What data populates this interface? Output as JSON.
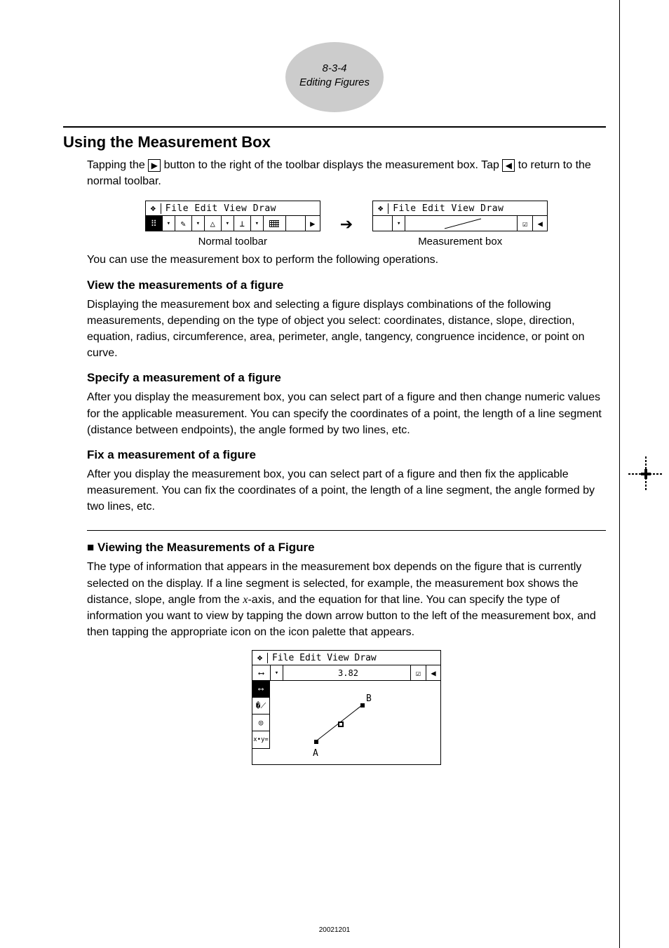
{
  "badge": {
    "line1": "8-3-4",
    "line2": "Editing Figures"
  },
  "h1": "Using the Measurement Box",
  "intro": {
    "seg1": "Tapping the ",
    "icon1": "▶",
    "seg2": " button to the right of the toolbar displays the measurement box. Tap ",
    "icon2": "◀",
    "seg3": " to return to the normal toolbar."
  },
  "menubar": {
    "crown": "❖",
    "file": "File",
    "edit": "Edit",
    "view": "View",
    "draw": "Draw"
  },
  "normal_toolbar_icons": [
    "⠿",
    "▾",
    "✎",
    "▾",
    "△",
    "▾",
    "⊥",
    "▾",
    "",
    "▶"
  ],
  "meas_toolbar": {
    "check": "☑",
    "back": "◀"
  },
  "captions": {
    "normal": "Normal toolbar",
    "meas": "Measurement box"
  },
  "p_intro2": "You can use the measurement box to perform the following operations.",
  "sec1": {
    "h": "View the measurements of a figure",
    "p": "Displaying the measurement box and selecting a figure displays combinations of the following measurements, depending on the type of object you select: coordinates, distance, slope, direction, equation, radius, circumference, area, perimeter, angle, tangency, congruence incidence, or point on curve."
  },
  "sec2": {
    "h": "Specify a measurement of a figure",
    "p": "After you display the measurement box, you can select part of a figure and then change numeric values for the applicable measurement. You can specify the coordinates of a point, the length of a line segment (distance between endpoints), the angle formed by two lines, etc."
  },
  "sec3": {
    "h": "Fix a measurement of a figure",
    "p": "After you display the measurement box, you can select part of a figure and then fix the applicable measurement. You can fix the coordinates of a point, the length of a line segment, the angle formed by two lines, etc."
  },
  "sec4": {
    "h_prefix": "■ ",
    "h": "Viewing the Measurements of a Figure",
    "p1_a": "The type of information that appears in the measurement box depends on the figure that is currently selected on the display. If a line segment is selected, for example, the measurement box shows the distance, slope, angle from the ",
    "x": "x",
    "p1_b": "-axis, and the equation for that line. You can specify the type of information you want to view by tapping the down arrow button to the left of the measurement box, and then tapping the appropriate icon on the icon palette that appears."
  },
  "fig": {
    "value": "3.82",
    "palette": [
      "⟷",
      "�⟋",
      "◎",
      "x•y="
    ],
    "ptA": "A",
    "ptB": "B"
  },
  "footer": "20021201"
}
